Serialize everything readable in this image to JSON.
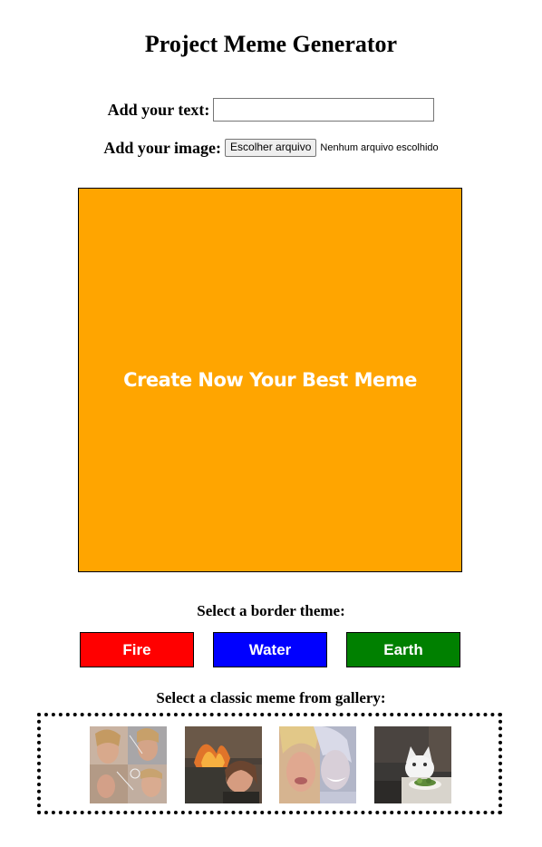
{
  "header": {
    "title": "Project Meme Generator"
  },
  "form": {
    "text_label": "Add your text:",
    "text_value": "",
    "image_label": "Add your image:",
    "file_button_label": "Escolher arquivo",
    "file_status": "Nenhum arquivo escolhido"
  },
  "meme": {
    "caption": "Create Now Your Best Meme",
    "background_color": "#ffa500"
  },
  "border_themes": {
    "label": "Select a border theme:",
    "buttons": [
      {
        "label": "Fire",
        "color": "#ff0000"
      },
      {
        "label": "Water",
        "color": "#0000ff"
      },
      {
        "label": "Earth",
        "color": "#008000"
      }
    ]
  },
  "gallery": {
    "label": "Select a classic meme from gallery:",
    "items": [
      "meme-thumbnail-1",
      "meme-thumbnail-2",
      "meme-thumbnail-3",
      "meme-thumbnail-4"
    ]
  }
}
